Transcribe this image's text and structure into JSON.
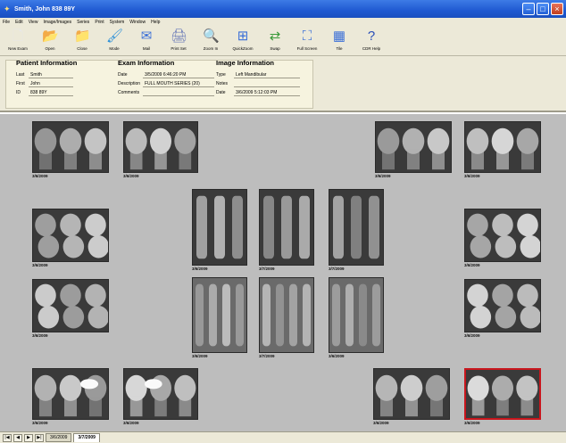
{
  "window": {
    "title": "Smith, John 838 89Y"
  },
  "menu": [
    "File",
    "Edit",
    "View",
    "Image/Images",
    "Series",
    "Print",
    "System",
    "Window",
    "Help"
  ],
  "toolbar": [
    {
      "label": "New Exam",
      "icon": "new-exam-icon",
      "glyph": "🗋"
    },
    {
      "label": "Open",
      "icon": "open-folder-icon",
      "glyph": "📂"
    },
    {
      "label": "Close",
      "icon": "close-folder-icon",
      "glyph": "📁"
    },
    {
      "label": "Mode",
      "icon": "mode-icon",
      "glyph": "🖌"
    },
    {
      "label": "Mail",
      "icon": "mail-icon",
      "glyph": "✉"
    },
    {
      "label": "Print Set",
      "icon": "printer-icon",
      "glyph": "🖨"
    },
    {
      "label": "Zoom In",
      "icon": "zoom-in-icon",
      "glyph": "🔍"
    },
    {
      "label": "QuickZoom",
      "icon": "quickzoom-icon",
      "glyph": "⊞"
    },
    {
      "label": "Swap",
      "icon": "swap-icon",
      "glyph": "⇄"
    },
    {
      "label": "Full Screen",
      "icon": "full-screen-icon",
      "glyph": "⛶"
    },
    {
      "label": "Tile",
      "icon": "tile-icon",
      "glyph": "▦"
    },
    {
      "label": "CDR Help",
      "icon": "help-icon",
      "glyph": "?"
    }
  ],
  "patient": {
    "heading": "Patient Information",
    "fields": [
      {
        "k": "Last",
        "v": "Smith"
      },
      {
        "k": "First",
        "v": "John"
      },
      {
        "k": "ID",
        "v": "838 89Y"
      }
    ]
  },
  "exam": {
    "heading": "Exam Information",
    "fields": [
      {
        "k": "Date",
        "v": "3/5/2009 6:46:20 PM"
      },
      {
        "k": "Description",
        "v": "FULL MOUTH SERIES (20)"
      },
      {
        "k": "Comments",
        "v": ""
      }
    ]
  },
  "image": {
    "heading": "Image Information",
    "fields": [
      {
        "k": "Type",
        "v": "Left Mandibular"
      },
      {
        "k": "Notes",
        "v": ""
      },
      {
        "k": "Date",
        "v": "3/6/2009 5:12:03 PM"
      }
    ]
  },
  "xrays": [
    {
      "date": "3/6/2009",
      "kind": "molar"
    },
    {
      "date": "3/6/2009",
      "kind": "molar"
    },
    {
      "date": "3/6/2009",
      "kind": "molar"
    },
    {
      "date": "3/6/2009",
      "kind": "molar"
    },
    {
      "date": "3/6/2009",
      "kind": "bitewing"
    },
    {
      "date": "3/6/2009",
      "kind": "anterior"
    },
    {
      "date": "3/7/2009",
      "kind": "anterior"
    },
    {
      "date": "3/7/2009",
      "kind": "anterior"
    },
    {
      "date": "3/6/2009",
      "kind": "bitewing"
    },
    {
      "date": "3/6/2009",
      "kind": "bitewing"
    },
    {
      "date": "3/6/2009",
      "kind": "incisor"
    },
    {
      "date": "3/7/2009",
      "kind": "incisor"
    },
    {
      "date": "3/6/2009",
      "kind": "incisor"
    },
    {
      "date": "3/6/2009",
      "kind": "bitewing"
    },
    {
      "date": "3/6/2009",
      "kind": "molar"
    },
    {
      "date": "3/6/2009",
      "kind": "molar"
    },
    {
      "date": "3/6/2009",
      "kind": "molar"
    },
    {
      "date": "3/6/2009",
      "kind": "molar",
      "selected": true
    }
  ],
  "tabs": {
    "nav": [
      "|◀",
      "◀",
      "▶",
      "▶|"
    ],
    "items": [
      {
        "label": "3/6/2009",
        "active": false
      },
      {
        "label": "3/7/2009",
        "active": true
      }
    ]
  },
  "colors": {
    "selected_border": "#c8161d",
    "viewer_bg": "#bdbdbd"
  }
}
